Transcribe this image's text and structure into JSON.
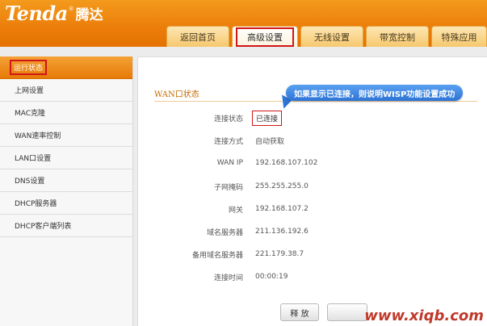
{
  "brand": {
    "name": "Tenda",
    "reg": "®",
    "cn_name": "腾达"
  },
  "nav": {
    "tabs": [
      {
        "label": "返回首页"
      },
      {
        "label": "高级设置"
      },
      {
        "label": "无线设置"
      },
      {
        "label": "带宽控制"
      },
      {
        "label": "特殊应用"
      }
    ]
  },
  "sidebar": {
    "items": [
      {
        "label": "运行状态"
      },
      {
        "label": "上网设置"
      },
      {
        "label": "MAC克隆"
      },
      {
        "label": "WAN速率控制"
      },
      {
        "label": "LAN口设置"
      },
      {
        "label": "DNS设置"
      },
      {
        "label": "DHCP服务器"
      },
      {
        "label": "DHCP客户端列表"
      }
    ]
  },
  "main": {
    "section_title": "WAN口状态",
    "callout": "如果显示已连接，则说明WISP功能设置成功",
    "rows": [
      {
        "label": "连接状态",
        "value": "已连接"
      },
      {
        "label": "连接方式",
        "value": "自动获取"
      },
      {
        "label": "WAN IP",
        "value": "192.168.107.102"
      },
      {
        "label": "子网掩码",
        "value": "255.255.255.0"
      },
      {
        "label": "网关",
        "value": "192.168.107.2"
      },
      {
        "label": "域名服务器",
        "value": "211.136.192.6"
      },
      {
        "label": "备用域名服务器",
        "value": "221.179.38.7"
      },
      {
        "label": "连接时间",
        "value": "00:00:19"
      }
    ],
    "release_button": "释 放"
  },
  "watermark": "www.xiqb.com"
}
